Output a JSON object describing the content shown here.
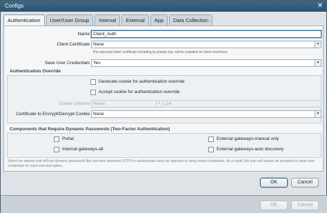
{
  "window": {
    "title": "Configs",
    "close_glyph": "✕"
  },
  "tabs": [
    {
      "label": "Authentication",
      "active": true
    },
    {
      "label": "User/User Group",
      "active": false
    },
    {
      "label": "Internal",
      "active": false
    },
    {
      "label": "External",
      "active": false
    },
    {
      "label": "App",
      "active": false
    },
    {
      "label": "Data Collection",
      "active": false
    }
  ],
  "form": {
    "name_label": "Name",
    "name_value": "Client_Auth",
    "client_cert_label": "Client Certificate",
    "client_cert_value": "None",
    "client_cert_hint": "The selected client certificate including its private key will be installed on client machines.",
    "save_creds_label": "Save User Credentials",
    "save_creds_value": "Yes"
  },
  "auth_override": {
    "title": "Authentication Override",
    "generate_cookie_label": "Generate cookie for authentication override",
    "accept_cookie_label": "Accept cookie for authentication override",
    "cookie_lifetime_label": "Cookie Lifetime",
    "cookie_lifetime_unit": "Hours",
    "cookie_lifetime_value": "24",
    "cert_label": "Certificate to Encrypt/Decrypt Cookie",
    "cert_value": "None"
  },
  "two_factor": {
    "title": "Components that Require Dynamic Passwords (Two-Factor Authentication)",
    "portal_label": "Portal",
    "internal_gw_label": "Internal gateways-all",
    "external_manual_label": "External gateways-manual only",
    "external_auto_label": "External gateways-auto discovery"
  },
  "footnote": "Select the options that will use dynamic passwords like one-time password (OTP) to authenticate users as opposed to using saved credentials. As a result, the user will always be prompted to enter new credentials for each selected option.",
  "buttons": {
    "ok": "OK",
    "cancel": "Cancel"
  },
  "outer_buttons": {
    "ok": "OK",
    "cancel": "Cancel"
  },
  "icons": {
    "dropdown": "▼"
  }
}
